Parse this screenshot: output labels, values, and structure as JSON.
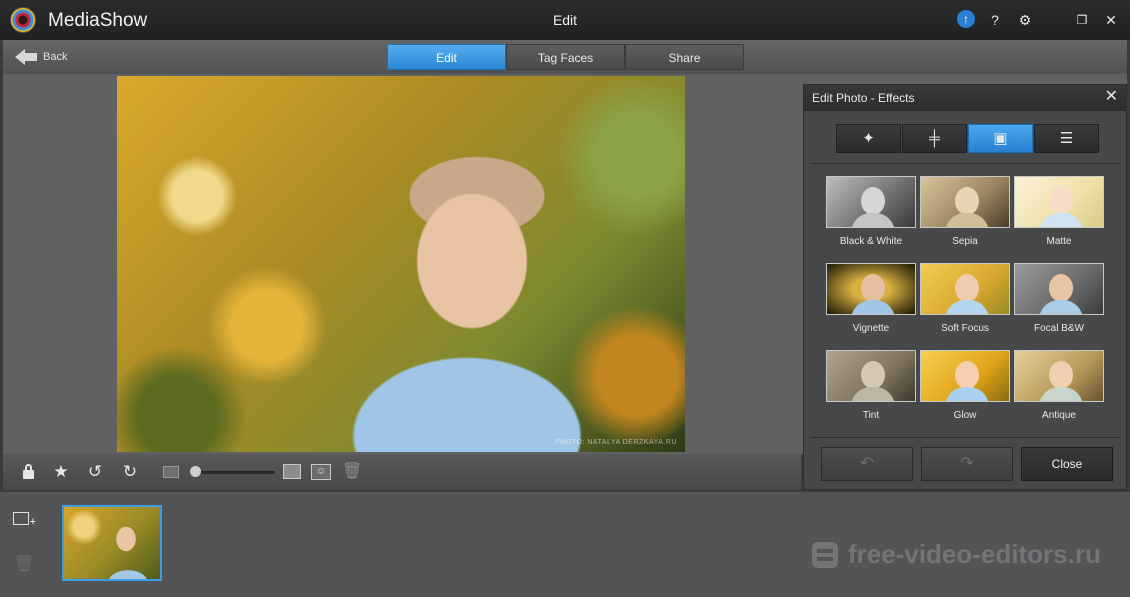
{
  "titlebar": {
    "app_name": "MediaShow",
    "window_title": "Edit",
    "controls": {
      "upgrade": "↑",
      "help": "?",
      "settings": "⚙",
      "restore": "❐",
      "close": "✕"
    }
  },
  "nav": {
    "back_label": "Back",
    "tabs": [
      {
        "label": "Edit",
        "active": true
      },
      {
        "label": "Tag Faces",
        "active": false
      },
      {
        "label": "Share",
        "active": false
      }
    ]
  },
  "photo": {
    "watermark": "PHOTO: NATALYA DERZKAYA.RU"
  },
  "toolbar": {
    "lock_icon": "lock-icon",
    "star": "★",
    "rotate_left": "↺",
    "rotate_right": "↻",
    "trash": "🗑",
    "zoom_level": 0.05
  },
  "panel": {
    "title": "Edit Photo - Effects",
    "close": "✕",
    "tabs": [
      {
        "icon": "magic-wand-icon",
        "glyph": "✦",
        "active": false
      },
      {
        "icon": "adjust-icon",
        "glyph": "╪",
        "active": false
      },
      {
        "icon": "effects-icon",
        "glyph": "▣",
        "active": true
      },
      {
        "icon": "list-icon",
        "glyph": "☰",
        "active": false
      }
    ],
    "effects": [
      {
        "label": "Black & White"
      },
      {
        "label": "Sepia"
      },
      {
        "label": "Matte"
      },
      {
        "label": "Vignette"
      },
      {
        "label": "Soft Focus"
      },
      {
        "label": "Focal B&W"
      },
      {
        "label": "Tint"
      },
      {
        "label": "Glow"
      },
      {
        "label": "Antique"
      }
    ],
    "undo_glyph": "↶",
    "redo_glyph": "↷",
    "close_label": "Close"
  },
  "filmstrip": {
    "import_plus": "+",
    "trash": "🗑"
  },
  "watermark": {
    "text": "free-video-editors.ru"
  },
  "colors": {
    "accent": "#2b86d4",
    "background": "#3a3b3d"
  }
}
